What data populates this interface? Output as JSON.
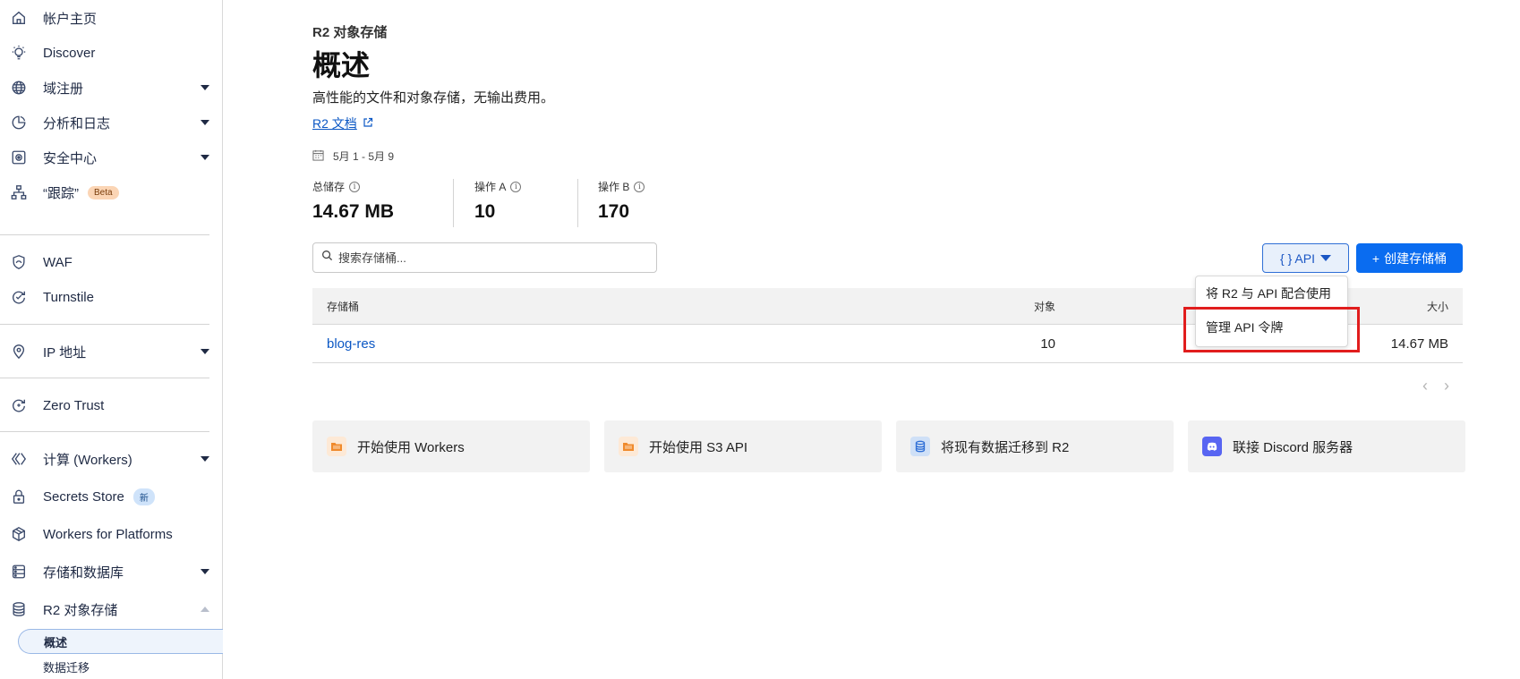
{
  "sidebar": {
    "items": [
      {
        "label": "帐户主页"
      },
      {
        "label": "Discover"
      },
      {
        "label": "域注册"
      },
      {
        "label": "分析和日志"
      },
      {
        "label": "安全中心"
      },
      {
        "label": "“跟踪”",
        "badge": "Beta"
      },
      {
        "label": "WAF"
      },
      {
        "label": "Turnstile"
      },
      {
        "label": "IP 地址"
      },
      {
        "label": "Zero Trust"
      },
      {
        "label": "计算 (Workers)"
      },
      {
        "label": "Secrets Store",
        "badge": "新"
      },
      {
        "label": "Workers for Platforms"
      },
      {
        "label": "存储和数据库"
      },
      {
        "label": "R2 对象存储"
      }
    ],
    "sub_items": [
      {
        "label": "概述"
      },
      {
        "label": "数据迁移"
      }
    ]
  },
  "header": {
    "eyebrow": "R2 对象存储",
    "title": "概述",
    "subtitle": "高性能的文件和对象存储，无输出费用。",
    "doc_link": "R2 文档",
    "date_range": "5月 1 - 5月 9"
  },
  "stats": [
    {
      "label": "总储存",
      "value": "14.67 MB"
    },
    {
      "label": "操作 A",
      "value": "10"
    },
    {
      "label": "操作 B",
      "value": "170"
    }
  ],
  "search": {
    "placeholder": "搜索存储桶..."
  },
  "buttons": {
    "api": "{ } API",
    "create": "创建存储桶"
  },
  "table": {
    "headers": {
      "name": "存储桶",
      "objects": "对象",
      "size": "大小"
    },
    "rows": [
      {
        "name": "blog-res",
        "objects": "10",
        "size": "14.67 MB"
      }
    ]
  },
  "dropdown": {
    "items": [
      {
        "label": "将 R2 与 API 配合使用"
      },
      {
        "label": "管理 API 令牌"
      }
    ]
  },
  "cards": [
    {
      "label": "开始使用 Workers",
      "icon": "folder-icon"
    },
    {
      "label": "开始使用 S3 API",
      "icon": "folder-icon"
    },
    {
      "label": "将现有数据迁移到 R2",
      "icon": "database-icon"
    },
    {
      "label": "联接 Discord 服务器",
      "icon": "discord-icon"
    }
  ],
  "colors": {
    "accent": "#0a6cf0",
    "link": "#0b57c4",
    "highlight": "#e11d1d"
  }
}
